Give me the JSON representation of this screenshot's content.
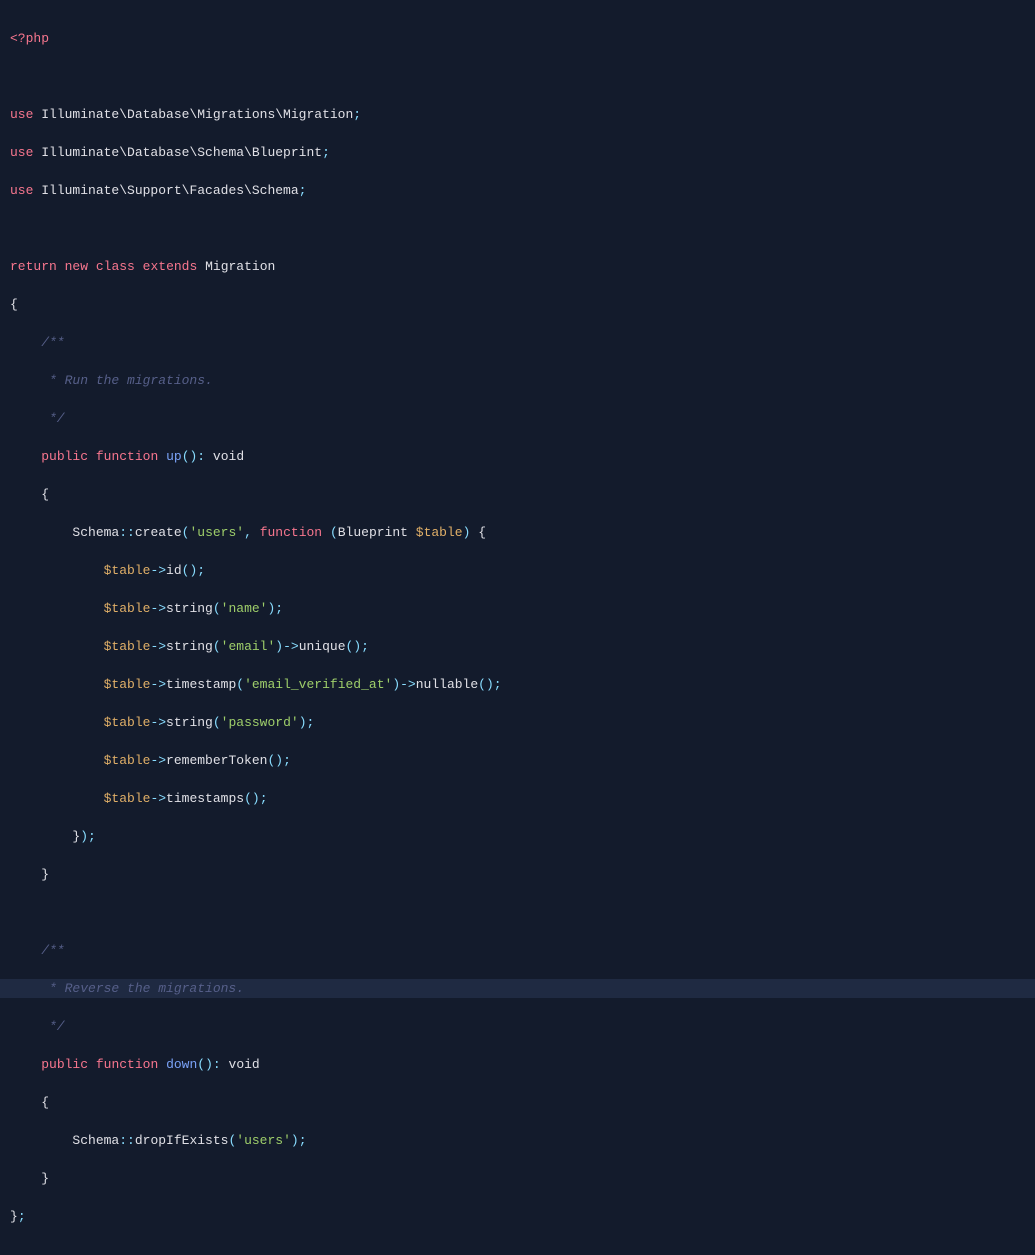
{
  "code": {
    "phpOpen": "<?php",
    "use1": {
      "kw": "use",
      "path": "Illuminate\\Database\\Migrations\\Migration",
      "semi": ";"
    },
    "use2": {
      "kw": "use",
      "path": "Illuminate\\Database\\Schema\\Blueprint",
      "semi": ";"
    },
    "use3": {
      "kw": "use",
      "path": "Illuminate\\Support\\Facades\\Schema",
      "semi": ";"
    },
    "returnLine": {
      "return": "return",
      "new": "new",
      "class": "class",
      "extends": "extends",
      "target": "Migration"
    },
    "braceOpen": "{",
    "doc1a": "    /**",
    "doc1b": "     * Run the migrations.",
    "doc1c": "     */",
    "upSig": {
      "indent": "    ",
      "vis": "public",
      "fn": "function",
      "name": "up",
      "parens": "()",
      "colon": ":",
      "ret": "void"
    },
    "brace4": "    {",
    "schemaCreate": {
      "indent": "        ",
      "schema": "Schema",
      "dcolon": "::",
      "create": "create",
      "po": "(",
      "arg1": "'users'",
      "comma": ",",
      "sp": " ",
      "fn": "function",
      "sp2": " ",
      "po2": "(",
      "type": "Blueprint",
      "sp3": " ",
      "var": "$table",
      "pc2": ")",
      "sp4": " ",
      "bo": "{"
    },
    "t1": {
      "indent": "            ",
      "var": "$table",
      "arrow": "->",
      "m": "id",
      "po": "(",
      "pc": ")",
      "semi": ";"
    },
    "t2": {
      "indent": "            ",
      "var": "$table",
      "arrow": "->",
      "m": "string",
      "po": "(",
      "arg": "'name'",
      "pc": ")",
      "semi": ";"
    },
    "t3": {
      "indent": "            ",
      "var": "$table",
      "arrow": "->",
      "m": "string",
      "po": "(",
      "arg": "'email'",
      "pc": ")",
      "arrow2": "->",
      "m2": "unique",
      "po2": "(",
      "pc2": ")",
      "semi": ";"
    },
    "t4": {
      "indent": "            ",
      "var": "$table",
      "arrow": "->",
      "m": "timestamp",
      "po": "(",
      "arg": "'email_verified_at'",
      "pc": ")",
      "arrow2": "->",
      "m2": "nullable",
      "po2": "(",
      "pc2": ")",
      "semi": ";"
    },
    "t5": {
      "indent": "            ",
      "var": "$table",
      "arrow": "->",
      "m": "string",
      "po": "(",
      "arg": "'password'",
      "pc": ")",
      "semi": ";"
    },
    "t6": {
      "indent": "            ",
      "var": "$table",
      "arrow": "->",
      "m": "rememberToken",
      "po": "(",
      "pc": ")",
      "semi": ";"
    },
    "t7": {
      "indent": "            ",
      "var": "$table",
      "arrow": "->",
      "m": "timestamps",
      "po": "(",
      "pc": ")",
      "semi": ";"
    },
    "closeCb": {
      "indent": "        ",
      "brace": "}",
      "pc": ")",
      "semi": ";"
    },
    "brace4c": "    }",
    "doc2a": "    /**",
    "doc2b": "     * Reverse the migrations.",
    "doc2c": "     */",
    "downSig": {
      "indent": "    ",
      "vis": "public",
      "fn": "function",
      "name": "down",
      "parens": "()",
      "colon": ":",
      "ret": "void"
    },
    "brace4d": "    {",
    "schemaDrop": {
      "indent": "        ",
      "schema": "Schema",
      "dcolon": "::",
      "drop": "dropIfExists",
      "po": "(",
      "arg": "'users'",
      "pc": ")",
      "semi": ";"
    },
    "brace4e": "    }",
    "braceClose": {
      "brace": "}",
      "semi": ";"
    }
  }
}
